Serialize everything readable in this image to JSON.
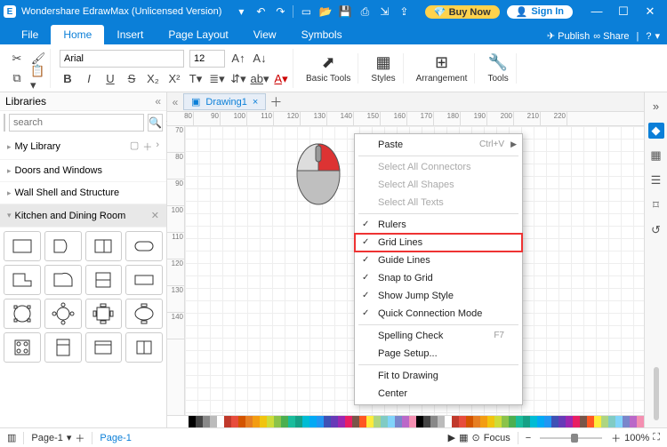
{
  "title": "Wondershare EdrawMax (Unlicensed Version)",
  "buy": "Buy Now",
  "signin": "Sign In",
  "menus": {
    "file": "File",
    "home": "Home",
    "insert": "Insert",
    "page": "Page Layout",
    "view": "View",
    "symbols": "Symbols",
    "publish": "Publish",
    "share": "Share"
  },
  "ribbon": {
    "font": "Arial",
    "size": "12",
    "basic": "Basic Tools",
    "styles": "Styles",
    "arrange": "Arrangement",
    "tools": "Tools"
  },
  "lib": {
    "header": "Libraries",
    "placeholder": "search",
    "sections": {
      "my": "My Library",
      "doors": "Doors and Windows",
      "wall": "Wall Shell and Structure",
      "kitchen": "Kitchen and Dining Room"
    }
  },
  "doc": {
    "tab": "Drawing1"
  },
  "hruler": [
    "80",
    "90",
    "100",
    "110",
    "120",
    "130",
    "140",
    "150",
    "160",
    "170",
    "180",
    "190",
    "200",
    "210",
    "220"
  ],
  "vruler": [
    "70",
    "80",
    "90",
    "100",
    "110",
    "120",
    "130",
    "140"
  ],
  "ctx": {
    "paste": "Paste",
    "paste_sc": "Ctrl+V",
    "selc": "Select All Connectors",
    "sels": "Select All Shapes",
    "selt": "Select All Texts",
    "rulers": "Rulers",
    "grid": "Grid Lines",
    "guide": "Guide Lines",
    "snap": "Snap to Grid",
    "jump": "Show Jump Style",
    "quick": "Quick Connection Mode",
    "spell": "Spelling Check",
    "spell_sc": "F7",
    "pagesetup": "Page Setup...",
    "fit": "Fit to Drawing",
    "center": "Center"
  },
  "status": {
    "page": "Page-1",
    "bpage": "Page-1",
    "focus": "Focus",
    "zoom": "100%"
  },
  "colors": [
    "#000",
    "#444",
    "#888",
    "#bbb",
    "#fff",
    "#c0392b",
    "#e74c3c",
    "#d35400",
    "#e67e22",
    "#f39c12",
    "#f1c40f",
    "#cddc39",
    "#8bc34a",
    "#4caf50",
    "#1abc9c",
    "#16a085",
    "#00bcd4",
    "#03a9f4",
    "#2196f3",
    "#3f51b5",
    "#673ab7",
    "#9c27b0",
    "#e91e63",
    "#795548",
    "#ff5722",
    "#ffeb3b",
    "#aed581",
    "#80cbc4",
    "#81d4fa",
    "#7986cb",
    "#ba68c8",
    "#f48fb1"
  ]
}
